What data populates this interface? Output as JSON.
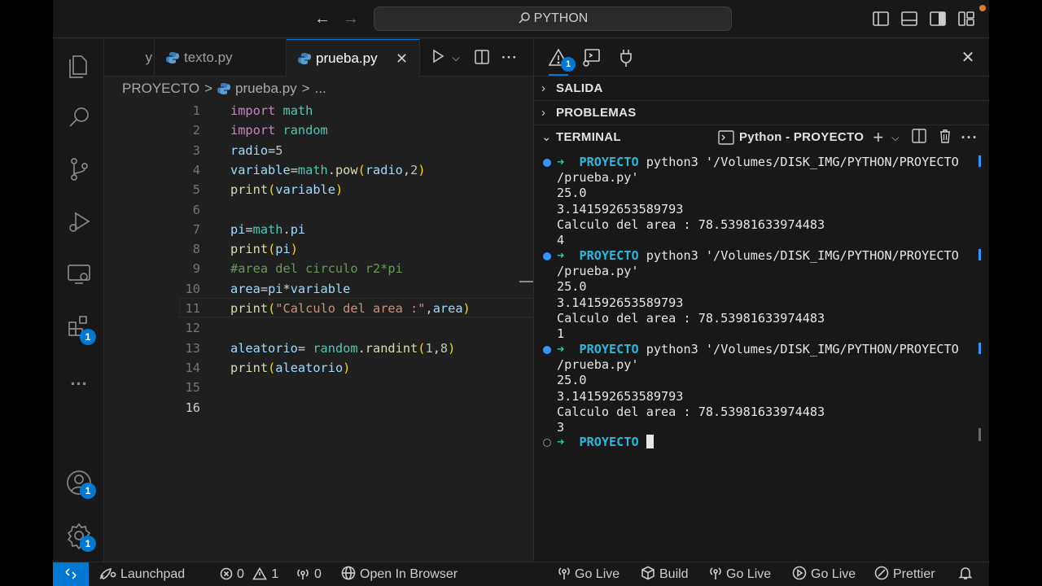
{
  "titlebar": {
    "search_text": "PYTHON",
    "back_icon": "arrow-left-icon",
    "forward_icon": "arrow-right-icon"
  },
  "tabs": [
    {
      "label": "y",
      "icon": "python-file-icon"
    },
    {
      "label": "texto.py",
      "icon": "python-file-icon"
    },
    {
      "label": "prueba.py",
      "icon": "python-file-icon",
      "active": true
    }
  ],
  "breadcrumb": {
    "folder": "PROYECTO",
    "sep": ">",
    "file": "prueba.py",
    "more": "..."
  },
  "editor": {
    "current_line": 16,
    "lines": [
      {
        "n": "1",
        "text": "import math"
      },
      {
        "n": "2",
        "text": "import random"
      },
      {
        "n": "3",
        "text": "radio=5"
      },
      {
        "n": "4",
        "text": "variable=math.pow(radio,2)"
      },
      {
        "n": "5",
        "text": "print(variable)"
      },
      {
        "n": "6",
        "text": ""
      },
      {
        "n": "7",
        "text": "pi=math.pi"
      },
      {
        "n": "8",
        "text": "print(pi)"
      },
      {
        "n": "9",
        "text": "#area del circulo r2*pi"
      },
      {
        "n": "10",
        "text": "area=pi*variable"
      },
      {
        "n": "11",
        "text": "print(\"Calculo del area :\",area)"
      },
      {
        "n": "12",
        "text": ""
      },
      {
        "n": "13",
        "text": "aleatorio= random.randint(1,8)"
      },
      {
        "n": "14",
        "text": "print(aleatorio)"
      },
      {
        "n": "15",
        "text": ""
      },
      {
        "n": "16",
        "text": ""
      }
    ]
  },
  "panel": {
    "problems_badge": "1",
    "sections": {
      "salida": "SALIDA",
      "problemas": "PROBLEMAS",
      "terminal": "TERMINAL"
    },
    "terminal_name": "Python - PROYECTO",
    "prompt_arrow": "➜",
    "prompt_dir": "PROYECTO",
    "runs": [
      {
        "command": "python3 '/Volumes/DISK_IMG/PYTHON/PROYECTO",
        "command_cont": "/prueba.py'",
        "output": [
          "25.0",
          "3.141592653589793",
          "Calculo del area : 78.53981633974483",
          "4"
        ]
      },
      {
        "command": "python3 '/Volumes/DISK_IMG/PYTHON/PROYECTO",
        "command_cont": "/prueba.py'",
        "output": [
          "25.0",
          "3.141592653589793",
          "Calculo del area : 78.53981633974483",
          "1"
        ]
      },
      {
        "command": "python3 '/Volumes/DISK_IMG/PYTHON/PROYECTO",
        "command_cont": "/prueba.py'",
        "output": [
          "25.0",
          "3.141592653589793",
          "Calculo del area : 78.53981633974483",
          "3"
        ]
      }
    ]
  },
  "activitybar": {
    "extensions_badge": "1",
    "accounts_badge": "1",
    "settings_badge": "1",
    "more": "..."
  },
  "statusbar": {
    "launchpad": "Launchpad",
    "errors": "0",
    "warnings": "1",
    "ports": "0",
    "open_in_browser": "Open In Browser",
    "go_live_1": "Go Live",
    "build": "Build",
    "go_live_2": "Go Live",
    "go_live_3": "Go Live",
    "prettier": "Prettier"
  },
  "colors": {
    "accent": "#0078d4",
    "prompt_arrow": "#23d18b",
    "prompt_dir": "#29b8db"
  }
}
